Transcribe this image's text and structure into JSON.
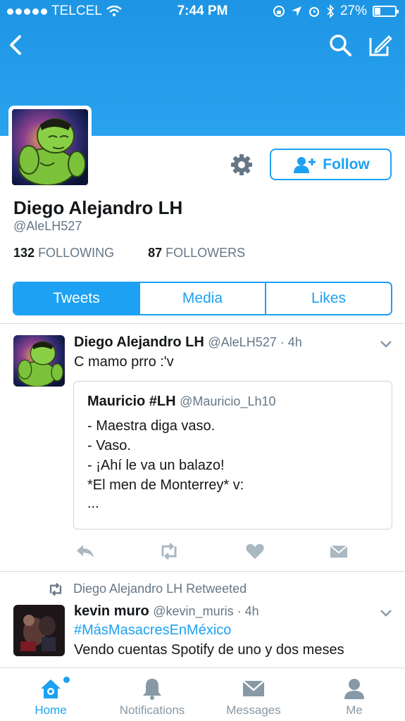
{
  "status_bar": {
    "carrier": "TELCEL",
    "time": "7:44 PM",
    "battery_percent": "27%",
    "battery_level": 0.27
  },
  "profile": {
    "display_name": "Diego Alejandro LH",
    "handle": "@AleLH527",
    "following_count": "132",
    "following_label": "FOLLOWING",
    "followers_count": "87",
    "followers_label": "FOLLOWERS",
    "follow_label": "Follow"
  },
  "tabs": [
    {
      "label": "Tweets",
      "active": true
    },
    {
      "label": "Media",
      "active": false
    },
    {
      "label": "Likes",
      "active": false
    }
  ],
  "tweet1": {
    "name": "Diego Alejandro LH",
    "meta": "@AleLH527 · 4h",
    "text": "C mamo prro :'v",
    "quote": {
      "name": "Mauricio #LH",
      "handle": "@Mauricio_Lh10",
      "lines": [
        "- Maestra diga vaso.",
        "- Vaso.",
        "- ¡Ahí le va un balazo!",
        "*El men de Monterrey* v:",
        "..."
      ]
    }
  },
  "retweet_note": "Diego Alejandro LH Retweeted",
  "tweet2": {
    "name": "kevin muro",
    "meta": "@kevin_muris · 4h",
    "hashtag": "#MásMasacresEnMéxico",
    "text": "Vendo cuentas Spotify de uno y dos meses"
  },
  "tabbar": {
    "home": "Home",
    "notifications": "Notifications",
    "messages": "Messages",
    "me": "Me"
  },
  "colors": {
    "accent": "#1da1f2",
    "banner": "#1d95e4",
    "muted": "#657786"
  }
}
